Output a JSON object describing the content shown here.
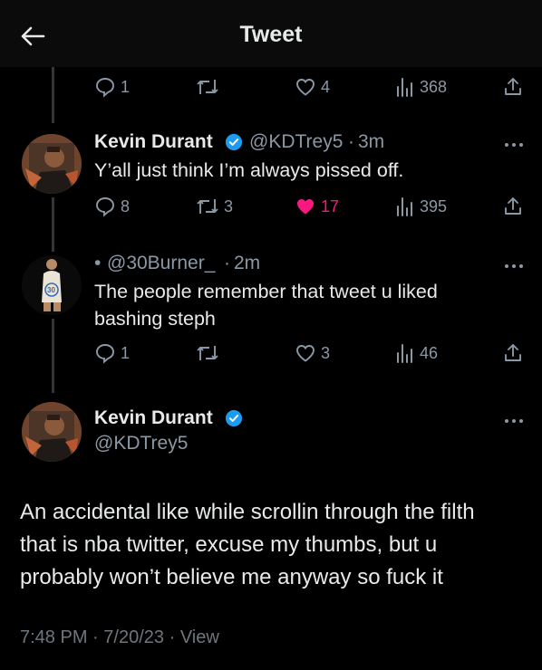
{
  "header": {
    "title": "Tweet"
  },
  "tweets": [
    {
      "reply": "1",
      "retweet": "",
      "like": "4",
      "views": "368"
    },
    {
      "name": "Kevin Durant",
      "handle": "@KDTrey5",
      "time": "3m",
      "text": "Y’all just think I’m always pissed off.",
      "reply": "8",
      "retweet": "3",
      "like": "17",
      "views": "395"
    },
    {
      "name": "",
      "handle": "@30Burner_",
      "time": "2m",
      "text_line1": "The people remember that tweet u liked",
      "text_line2": "bashing steph",
      "reply": "1",
      "retweet": "",
      "like": "3",
      "views": "46"
    }
  ],
  "main_tweet": {
    "name": "Kevin Durant",
    "handle": "@KDTrey5",
    "text_line1": "An accidental like while scrollin through the filth",
    "text_line2": "that is nba twitter, excuse my thumbs, but u",
    "text_line3": "probably won’t believe me anyway so fuck it",
    "time": "7:48 PM",
    "date": "7/20/23",
    "view_label": "View"
  },
  "separator": "·",
  "colors": {
    "background": "#000000",
    "text": "#e7e9ea",
    "secondary": "#8b98a5",
    "like_active": "#f91880",
    "verified": "#1d9bf0"
  },
  "icons": [
    "back-arrow-icon",
    "reply-icon",
    "retweet-icon",
    "heart-icon",
    "views-icon",
    "share-icon",
    "verified-badge-icon",
    "more-icon"
  ]
}
